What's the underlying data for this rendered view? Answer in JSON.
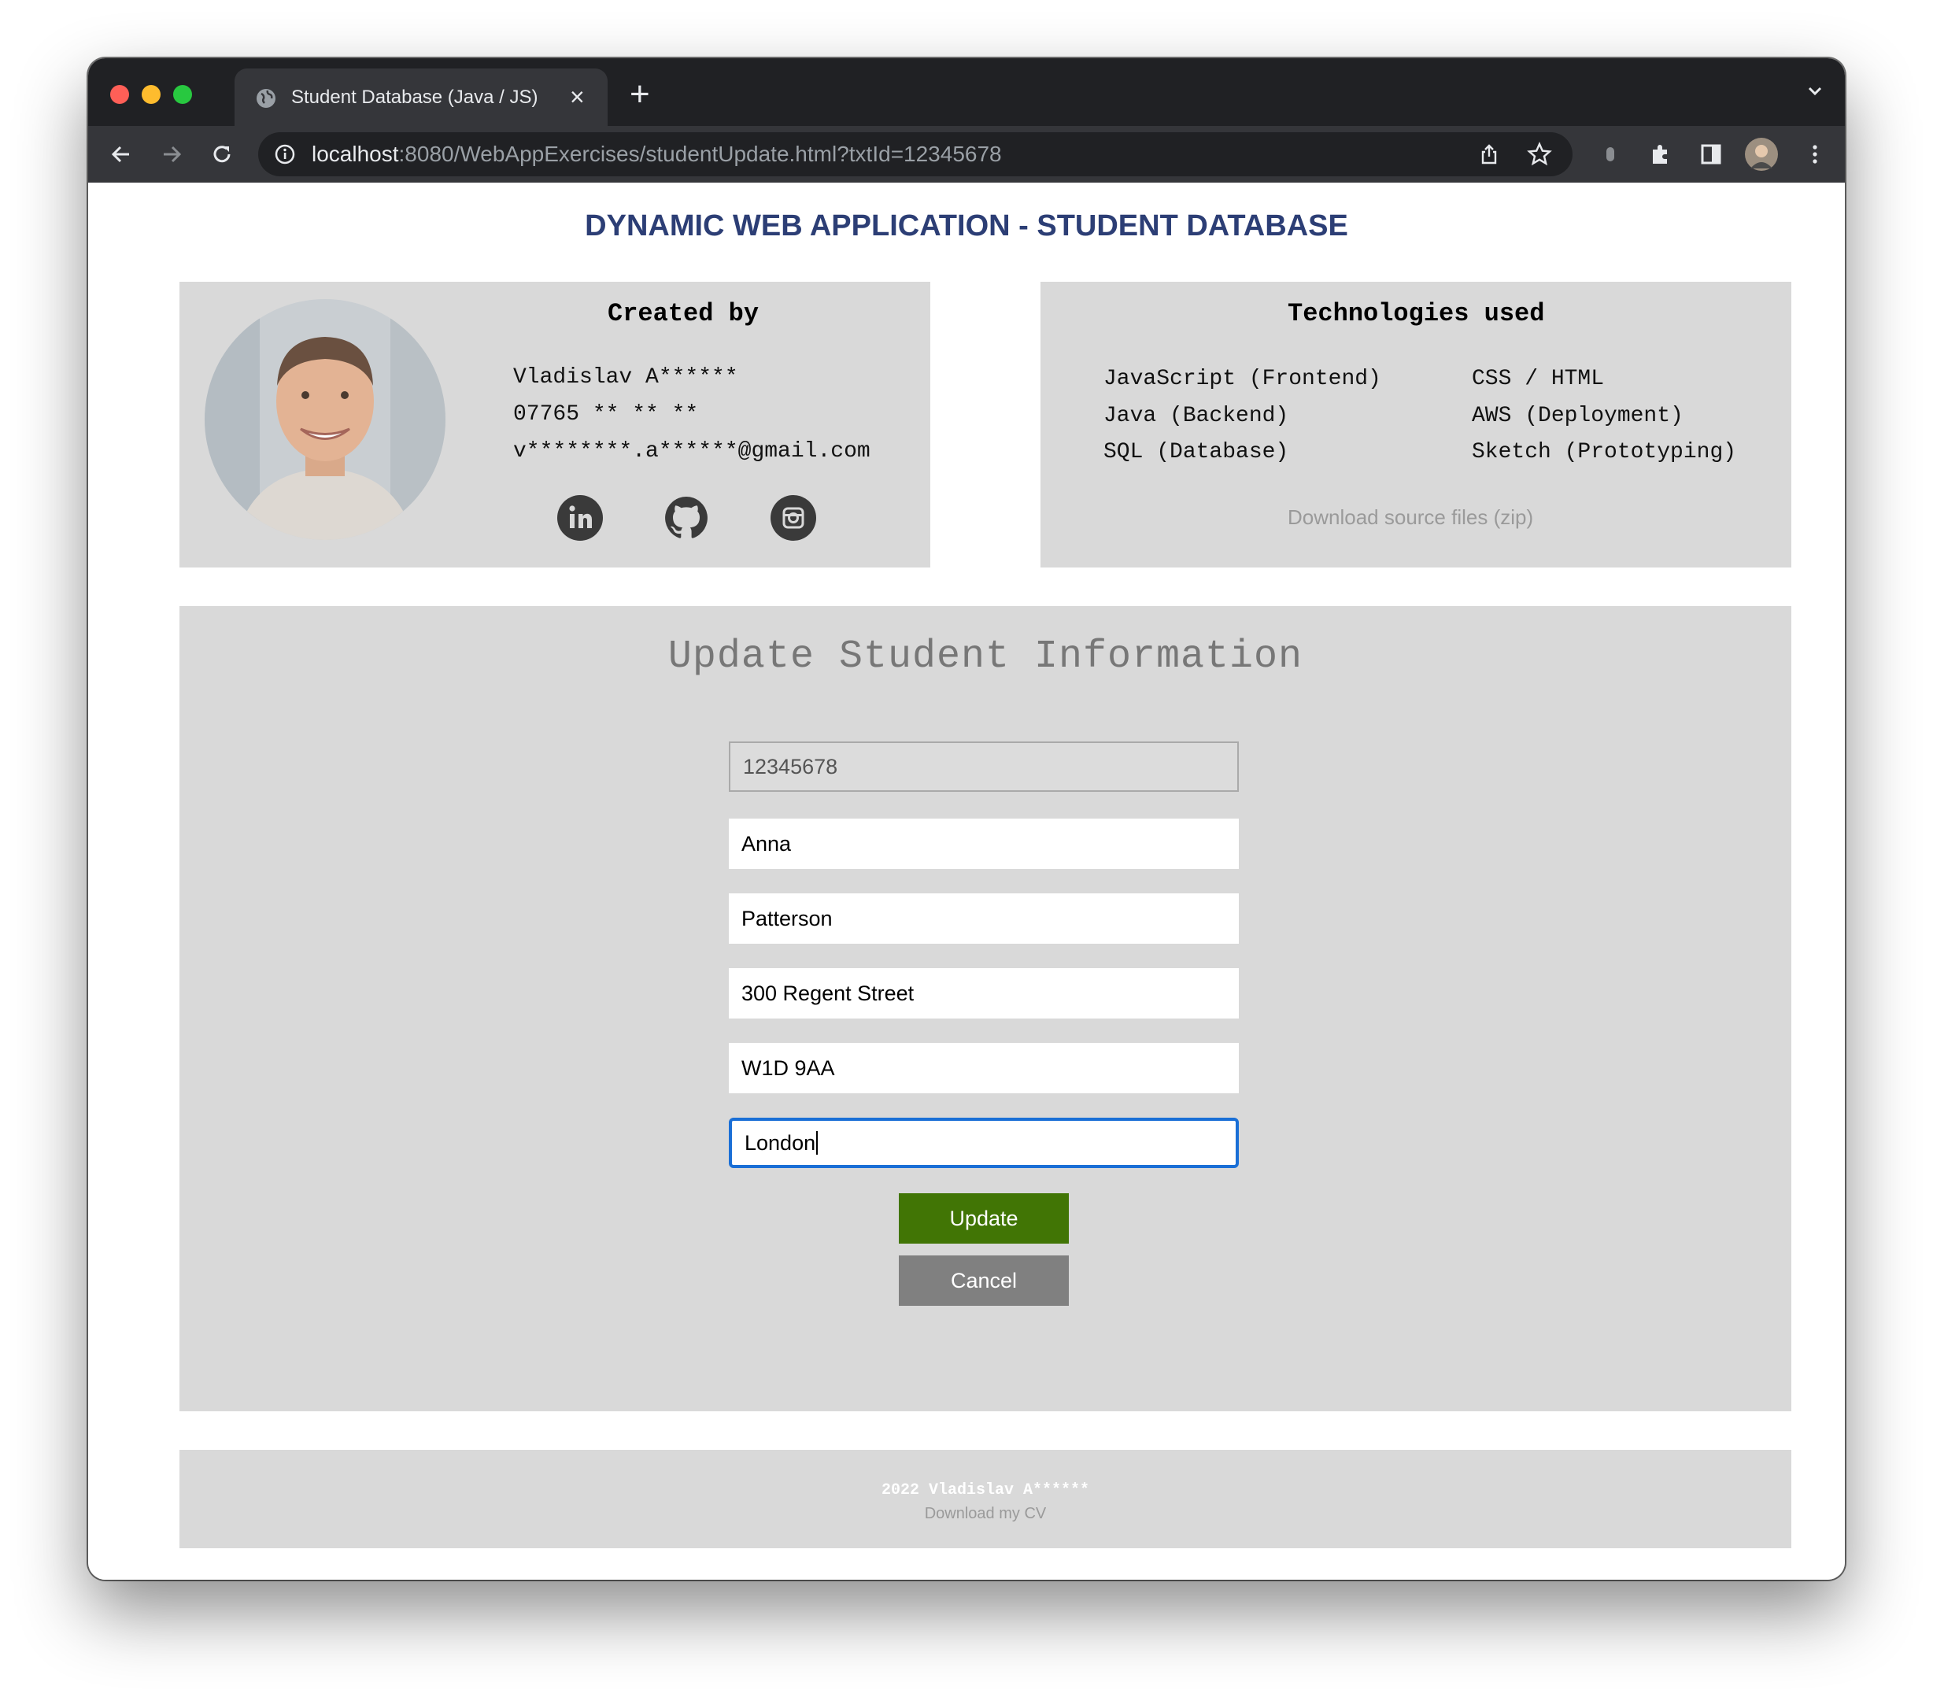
{
  "browser": {
    "tab_title": "Student Database (Java / JS)",
    "url_host": "localhost",
    "url_rest": ":8080/WebAppExercises/studentUpdate.html?txtId=12345678"
  },
  "page": {
    "title": "DYNAMIC WEB APPLICATION - STUDENT DATABASE"
  },
  "creator": {
    "heading": "Created by",
    "name": "Vladislav A******",
    "phone": "07765 ** ** **",
    "email": "v********.a******@gmail.com",
    "social": [
      "linkedin-icon",
      "github-icon",
      "instagram-icon"
    ]
  },
  "technologies": {
    "heading": "Technologies used",
    "left": [
      "JavaScript (Frontend)",
      "Java (Backend)",
      "SQL (Database)"
    ],
    "right": [
      "CSS / HTML",
      "AWS (Deployment)",
      "Sketch (Prototyping)"
    ],
    "download_link": "Download source files (zip)"
  },
  "form": {
    "title": "Update Student Information",
    "fields": [
      {
        "value": "12345678"
      },
      {
        "value": "Anna"
      },
      {
        "value": "Patterson"
      },
      {
        "value": "300 Regent Street"
      },
      {
        "value": "W1D 9AA"
      },
      {
        "value": "London"
      }
    ],
    "update_label": "Update",
    "cancel_label": "Cancel"
  },
  "footer": {
    "copyright": "2022 Vladislav A******",
    "cv_link": "Download my CV"
  },
  "colors": {
    "accent_title": "#2c3e75",
    "update_button": "#417505",
    "cancel_button": "#808080",
    "panel_bg": "#d9d9d9",
    "focus_ring": "#1a6fd6"
  }
}
